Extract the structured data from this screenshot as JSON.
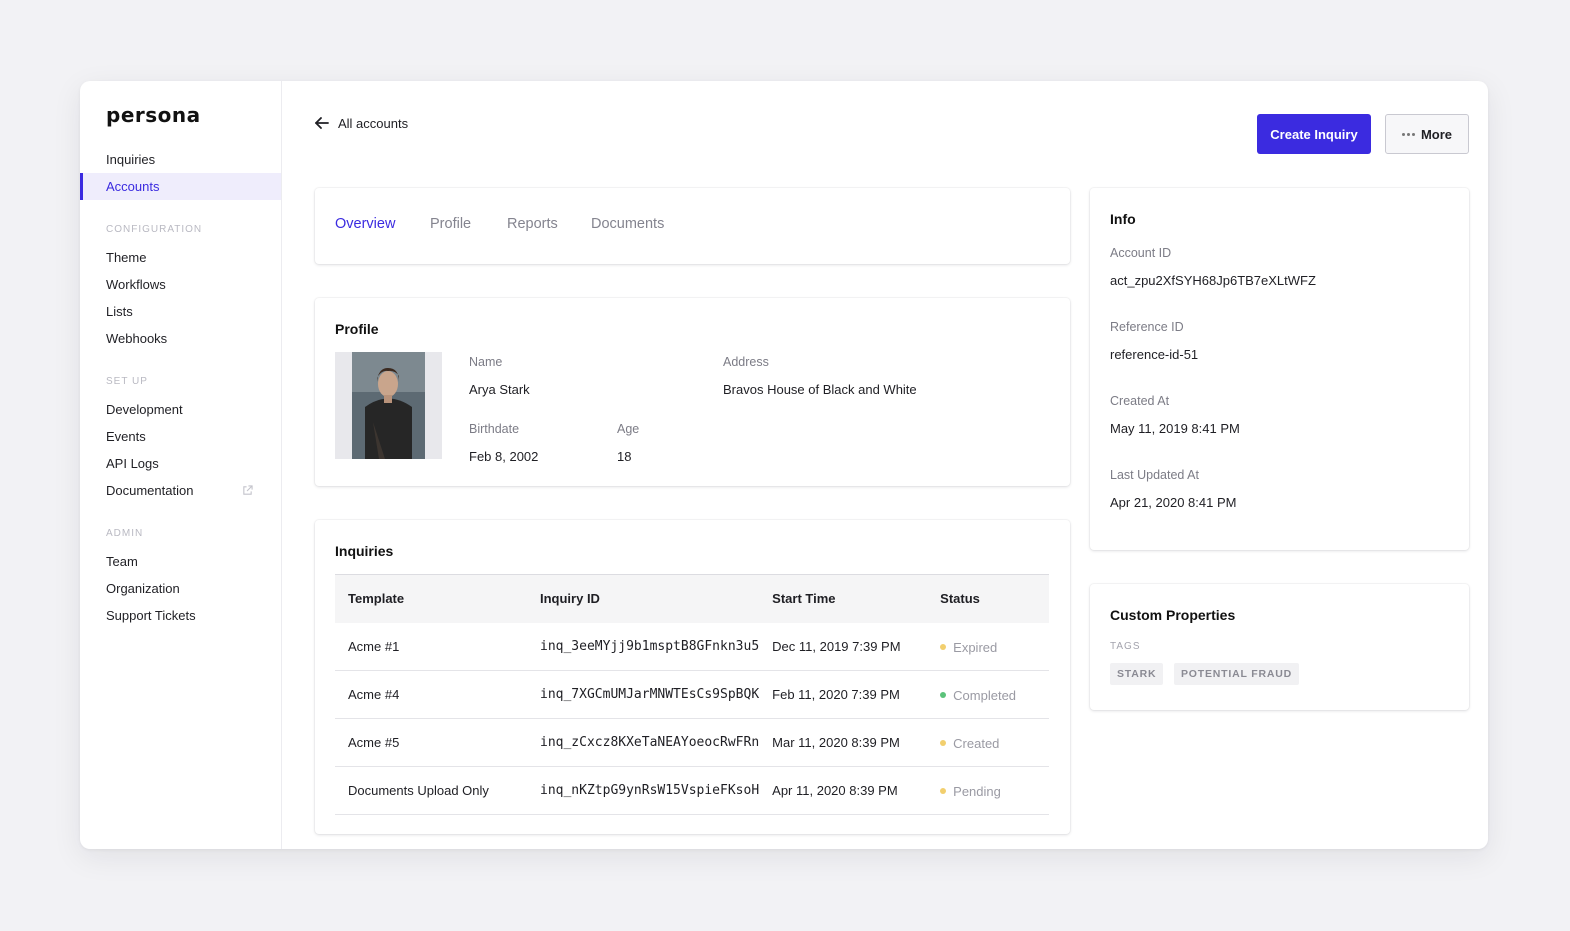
{
  "app": {
    "logo": "persona"
  },
  "sidebar": {
    "top_items": [
      {
        "label": "Inquiries"
      },
      {
        "label": "Accounts",
        "active": true
      }
    ],
    "sections": [
      {
        "title": "CONFIGURATION",
        "items": [
          {
            "label": "Theme"
          },
          {
            "label": "Workflows"
          },
          {
            "label": "Lists"
          },
          {
            "label": "Webhooks"
          }
        ]
      },
      {
        "title": "SET UP",
        "items": [
          {
            "label": "Development"
          },
          {
            "label": "Events"
          },
          {
            "label": "API Logs"
          },
          {
            "label": "Documentation",
            "icon": "external-link-icon"
          }
        ]
      },
      {
        "title": "ADMIN",
        "items": [
          {
            "label": "Team"
          },
          {
            "label": "Organization"
          },
          {
            "label": "Support Tickets"
          }
        ]
      }
    ]
  },
  "header": {
    "back_label": "All accounts",
    "back_icon": "arrow-left-icon",
    "create_button": "Create Inquiry",
    "more_button": "More",
    "more_icon": "ellipsis-icon"
  },
  "tabs": [
    {
      "label": "Overview",
      "active": true
    },
    {
      "label": "Profile"
    },
    {
      "label": "Reports"
    },
    {
      "label": "Documents"
    }
  ],
  "profile": {
    "title": "Profile",
    "name_label": "Name",
    "name": "Arya Stark",
    "address_label": "Address",
    "address": "Bravos House of Black and White",
    "birthdate_label": "Birthdate",
    "birthdate": "Feb 8, 2002",
    "age_label": "Age",
    "age": "18"
  },
  "inquiries": {
    "title": "Inquiries",
    "columns": [
      "Template",
      "Inquiry ID",
      "Start Time",
      "Status"
    ],
    "rows": [
      {
        "template": "Acme #1",
        "id": "inq_3eeMYjj9b1msptB8GFnkn3u5",
        "start": "Dec 11, 2019 7:39 PM",
        "status": "Expired",
        "status_color": "#f2cf6e"
      },
      {
        "template": "Acme #4",
        "id": "inq_7XGCmUMJarMNWTEsCs9SpBQK",
        "start": "Feb 11, 2020 7:39 PM",
        "status": "Completed",
        "status_color": "#5bc27a"
      },
      {
        "template": "Acme #5",
        "id": "inq_zCxcz8KXeTaNEAYoeocRwFRn",
        "start": "Mar 11, 2020 8:39 PM",
        "status": "Created",
        "status_color": "#f2cf6e"
      },
      {
        "template": "Documents Upload Only",
        "id": "inq_nKZtpG9ynRsW15VspieFKsoH",
        "start": "Apr 11, 2020 8:39 PM",
        "status": "Pending",
        "status_color": "#f2cf6e"
      }
    ]
  },
  "info": {
    "title": "Info",
    "account_id_label": "Account ID",
    "account_id": "act_zpu2XfSYH68Jp6TB7eXLtWFZ",
    "reference_id_label": "Reference ID",
    "reference_id": "reference-id-51",
    "created_label": "Created At",
    "created": "May 11, 2019 8:41 PM",
    "updated_label": "Last Updated At",
    "updated": "Apr 21, 2020 8:41 PM"
  },
  "custom": {
    "title": "Custom Properties",
    "tags_label": "TAGS",
    "tags": [
      "STARK",
      "POTENTIAL FRAUD"
    ]
  },
  "colors": {
    "accent": "#3b2be0",
    "active_bg": "#efedfc"
  }
}
